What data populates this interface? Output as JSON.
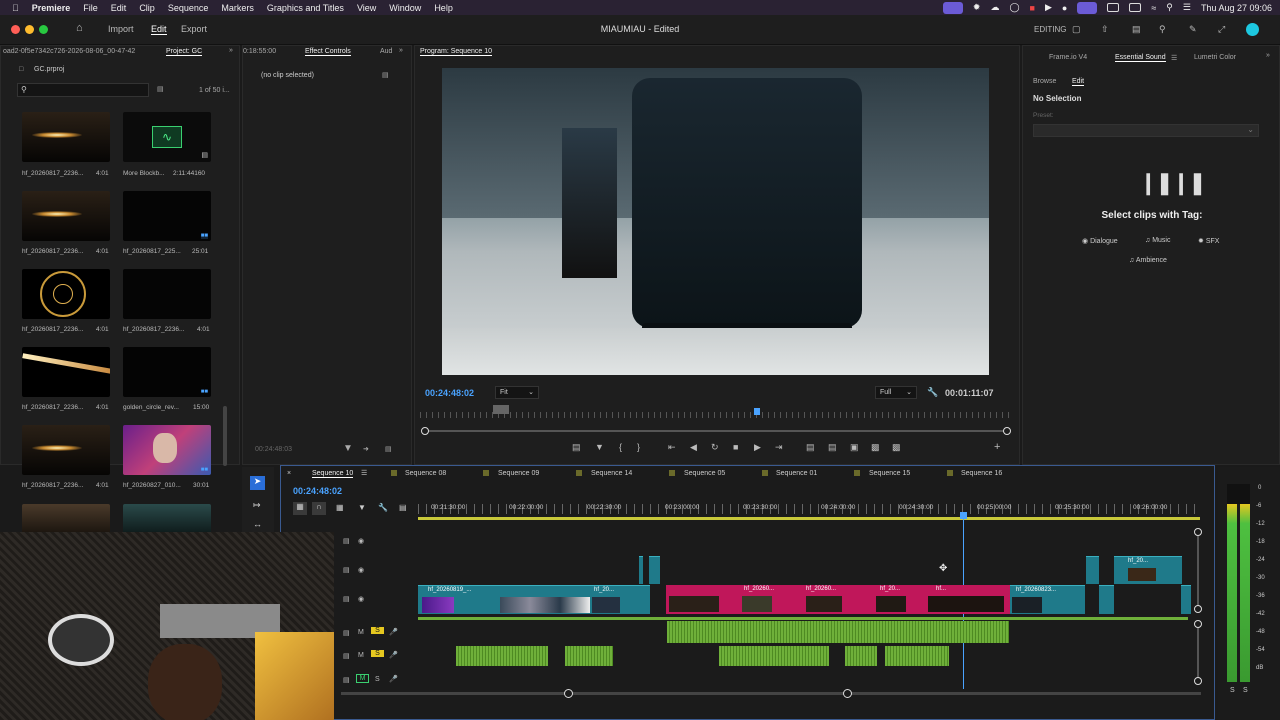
{
  "menubar": {
    "apple": "",
    "app": "Premiere",
    "items": [
      "File",
      "Edit",
      "Clip",
      "Sequence",
      "Markers",
      "Graphics and Titles",
      "View",
      "Window",
      "Help"
    ],
    "datetime": "Thu Aug 27  09:06"
  },
  "header": {
    "nav": [
      "Import",
      "Edit",
      "Export"
    ],
    "active": "Edit",
    "title": "MIAUMIAU - Edited",
    "workspace": "EDITING"
  },
  "project": {
    "breadcrumb": "oad2-0f5e7342c726-2026-08-06_00-47-42",
    "tab": "Project: GC",
    "file": "GC.prproj",
    "count": "1 of 50 i...",
    "items": [
      {
        "name": "hf_20260817_2236...",
        "dur": "4:01"
      },
      {
        "name": "More Blockb...",
        "dur": "2:11:44160"
      },
      {
        "name": "hf_20260817_2236...",
        "dur": "4:01"
      },
      {
        "name": "hf_20260817_225...",
        "dur": "25:01"
      },
      {
        "name": "hf_20260817_2236...",
        "dur": "4:01"
      },
      {
        "name": "hf_20260817_2236...",
        "dur": "4:01"
      },
      {
        "name": "hf_20260817_2236...",
        "dur": "4:01"
      },
      {
        "name": "golden_circle_rev...",
        "dur": "15:00"
      },
      {
        "name": "hf_20260817_2236...",
        "dur": "4:01"
      },
      {
        "name": "hf_20260827_010...",
        "dur": "30:01"
      }
    ]
  },
  "effects": {
    "tc_left": "0:18:55:00",
    "tab": "Effect Controls",
    "tab2": "Aud",
    "no_clip": "(no clip selected)",
    "tc_bottom": "00:24:48:03"
  },
  "program": {
    "tab": "Program: Sequence 10",
    "timecode": "00:24:48:02",
    "fit": "Fit",
    "quality": "Full",
    "duration": "00:01:11:07"
  },
  "right_panel": {
    "tabs": [
      "Frame.io V4",
      "Essential Sound",
      "Lumetri Color"
    ],
    "subtabs": [
      "Browse",
      "Edit"
    ],
    "selection": "No Selection",
    "preset_label": "Preset:",
    "heading": "Select clips with Tag:",
    "tags": [
      "Dialogue",
      "Music",
      "SFX",
      "Ambience"
    ]
  },
  "timeline": {
    "sequences": [
      "Sequence 10",
      "Sequence 08",
      "Sequence 09",
      "Sequence 14",
      "Sequence 05",
      "Sequence 01",
      "Sequence 15",
      "Sequence 16"
    ],
    "timecode": "00:24:48:02",
    "ruler": [
      "00:21:30:00",
      "00:22:00:00",
      "00:22:30:00",
      "00:23:00:00",
      "00:23:30:00",
      "00:24:00:00",
      "00:24:30:00",
      "00:25:00:00",
      "00:25:30:00",
      "00:26:00:00"
    ],
    "clip_labels": [
      "hf_20260819_...",
      "hf_20...",
      "hf_20260...",
      "hf_20260...",
      "hf_20...",
      "hf...",
      "hf_20260823...",
      "hf_20..."
    ],
    "track_ctl": {
      "m": "M",
      "s": "S"
    }
  },
  "meter": {
    "labels": [
      "0",
      "-6",
      "-12",
      "-18",
      "-24",
      "-30",
      "-36",
      "-42",
      "-48",
      "-54",
      "dB"
    ],
    "solo": [
      "S",
      "S"
    ]
  },
  "colors": {
    "accent": "#4aa3ff",
    "pink": "#c0175a",
    "teal": "#1f7a8a",
    "green": "#6fb03a"
  }
}
